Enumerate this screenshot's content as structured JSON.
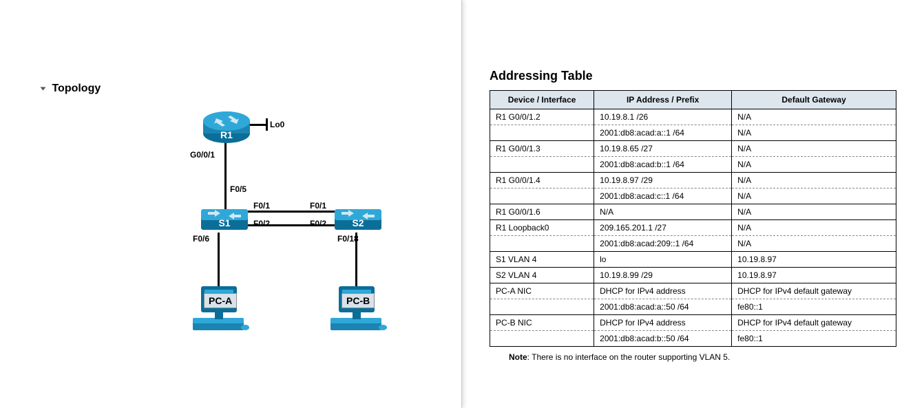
{
  "left": {
    "section_title": "Topology",
    "devices": {
      "router": "R1",
      "switch1": "S1",
      "switch2": "S2",
      "pcA": "PC-A",
      "pcB": "PC-B"
    },
    "labels": {
      "lo0": "Lo0",
      "g001": "G0/0/1",
      "f05": "F0/5",
      "s1_f01": "F0/1",
      "s1_f02": "F0/2",
      "s2_f01": "F0/1",
      "s2_f02": "F0/2",
      "s1_f06": "F0/6",
      "s2_f018": "F0/18"
    }
  },
  "right": {
    "heading": "Addressing Table",
    "headers": [
      "Device / Interface",
      "IP Address / Prefix",
      "Default Gateway"
    ],
    "rows": [
      {
        "style": "solid",
        "cells": [
          "R1 G0/0/1.2",
          "10.19.8.1 /26",
          "N/A"
        ]
      },
      {
        "style": "dash",
        "cells": [
          "",
          "2001:db8:acad:a::1 /64",
          "N/A"
        ]
      },
      {
        "style": "solid",
        "cells": [
          "R1 G0/0/1.3",
          "10.19.8.65 /27",
          "N/A"
        ]
      },
      {
        "style": "dash",
        "cells": [
          "",
          "2001:db8:acad:b::1 /64",
          "N/A"
        ]
      },
      {
        "style": "solid",
        "cells": [
          "R1 G0/0/1.4",
          "10.19.8.97 /29",
          "N/A"
        ]
      },
      {
        "style": "dash",
        "cells": [
          "",
          "2001:db8:acad:c::1 /64",
          "N/A"
        ]
      },
      {
        "style": "solid",
        "cells": [
          "R1 G0/0/1.6",
          "N/A",
          "N/A"
        ]
      },
      {
        "style": "solid",
        "cells": [
          "R1 Loopback0",
          "209.165.201.1 /27",
          "N/A"
        ]
      },
      {
        "style": "dash",
        "cells": [
          "",
          "2001:db8:acad:209::1 /64",
          "N/A"
        ]
      },
      {
        "style": "solid",
        "cells": [
          "S1 VLAN 4",
          "lo",
          "10.19.8.97"
        ]
      },
      {
        "style": "solid",
        "cells": [
          "S2 VLAN 4",
          "10.19.8.99 /29",
          "10.19.8.97"
        ]
      },
      {
        "style": "solid",
        "cells": [
          "PC-A NIC",
          "DHCP for IPv4 address",
          "DHCP for IPv4 default gateway"
        ]
      },
      {
        "style": "dash",
        "cells": [
          "",
          "2001:db8:acad:a::50 /64",
          "fe80::1"
        ]
      },
      {
        "style": "solid",
        "cells": [
          "PC-B NIC",
          "DHCP for IPv4 address",
          "DHCP for IPv4 default gateway"
        ]
      },
      {
        "style": "dash",
        "cells": [
          "",
          "2001:db8:acad:b::50 /64",
          "fe80::1"
        ]
      }
    ],
    "note_prefix": "Note",
    "note_text": ": There is no interface on the router supporting VLAN 5."
  }
}
